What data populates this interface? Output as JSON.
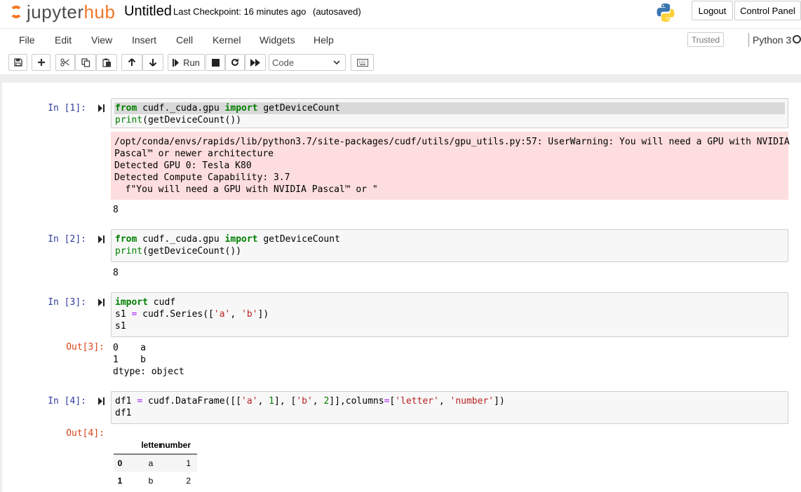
{
  "header": {
    "logo_text_left": "jupyter",
    "logo_text_right": "hub",
    "notebook_name": "Untitled",
    "checkpoint": "Last Checkpoint: 16 minutes ago",
    "autosave": "(autosaved)",
    "logout_label": "Logout",
    "control_panel_label": "Control Panel"
  },
  "menubar": {
    "items": [
      "File",
      "Edit",
      "View",
      "Insert",
      "Cell",
      "Kernel",
      "Widgets",
      "Help"
    ],
    "trusted": "Trusted",
    "kernel": "Python 3"
  },
  "toolbar": {
    "run_label": "Run",
    "cell_type": "Code",
    "icons": [
      "save-icon",
      "plus-icon",
      "cut-icon",
      "copy-icon",
      "paste-icon",
      "arrow-up-icon",
      "arrow-down-icon",
      "step-forward-icon",
      "stop-icon",
      "restart-icon",
      "fast-forward-icon",
      "keyboard-icon"
    ]
  },
  "cells": [
    {
      "prompt": "In [1]:",
      "code": [
        "from cudf._cuda.gpu import getDeviceCount",
        "print(getDeviceCount())"
      ],
      "stderr": [
        "/opt/conda/envs/rapids/lib/python3.7/site-packages/cudf/utils/gpu_utils.py:57: UserWarning: You will need a GPU with NVIDIA",
        "Pascal™ or newer architecture",
        "Detected GPU 0: Tesla K80",
        "Detected Compute Capability: 3.7",
        "  f\"You will need a GPU with NVIDIA Pascal™ or \""
      ],
      "stdout": "8"
    },
    {
      "prompt": "In [2]:",
      "code": [
        "from cudf._cuda.gpu import getDeviceCount",
        "print(getDeviceCount())"
      ],
      "stdout": "8"
    },
    {
      "prompt": "In [3]:",
      "code": [
        "import cudf",
        "s1 = cudf.Series(['a', 'b'])",
        "s1"
      ],
      "out_prompt": "Out[3]:",
      "output": [
        "0    a",
        "1    b",
        "dtype: object"
      ]
    },
    {
      "prompt": "In [4]:",
      "code": [
        "df1 = cudf.DataFrame([['a', 1], ['b', 2]],columns=['letter', 'number'])",
        "df1"
      ],
      "out_prompt": "Out[4]:",
      "table": {
        "columns": [
          "letter",
          "number"
        ],
        "rows": [
          [
            "0",
            "a",
            "1"
          ],
          [
            "1",
            "b",
            "2"
          ]
        ]
      }
    }
  ]
}
